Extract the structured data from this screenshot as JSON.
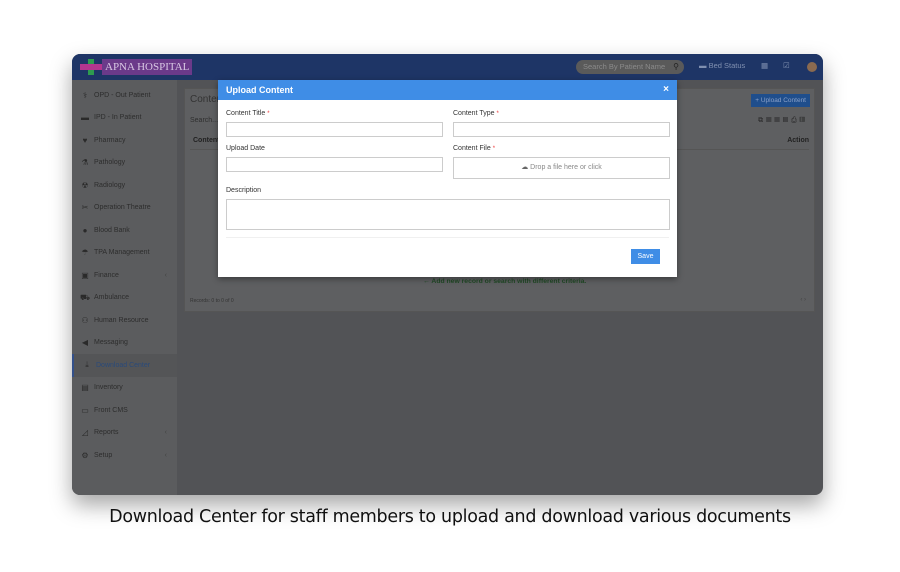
{
  "header": {
    "logo_text": "APNA HOSPITAL",
    "search_placeholder": "Search By Patient Name",
    "bed_status": "Bed Status"
  },
  "sidebar": {
    "items": [
      {
        "label": "OPD - Out Patient",
        "icon": "stethoscope-icon",
        "glyph": "⚕"
      },
      {
        "label": "IPD - In Patient",
        "icon": "bed-icon",
        "glyph": "▬"
      },
      {
        "label": "Pharmacy",
        "icon": "mortar-pestle-icon",
        "glyph": "♥"
      },
      {
        "label": "Pathology",
        "icon": "flask-icon",
        "glyph": "⚗"
      },
      {
        "label": "Radiology",
        "icon": "xray-icon",
        "glyph": "☢"
      },
      {
        "label": "Operation Theatre",
        "icon": "scissors-icon",
        "glyph": "✂"
      },
      {
        "label": "Blood Bank",
        "icon": "tint-icon",
        "glyph": "●"
      },
      {
        "label": "TPA Management",
        "icon": "umbrella-icon",
        "glyph": "☂"
      },
      {
        "label": "Finance",
        "icon": "money-icon",
        "glyph": "▣",
        "chevron": "‹"
      },
      {
        "label": "Ambulance",
        "icon": "ambulance-icon",
        "glyph": "⛟"
      },
      {
        "label": "Human Resource",
        "icon": "sitemap-icon",
        "glyph": "⚇"
      },
      {
        "label": "Messaging",
        "icon": "bullhorn-icon",
        "glyph": "◀"
      },
      {
        "label": "Download Center",
        "icon": "download-icon",
        "glyph": "⤓",
        "active": true
      },
      {
        "label": "Inventory",
        "icon": "inventory-icon",
        "glyph": "▤"
      },
      {
        "label": "Front CMS",
        "icon": "desktop-icon",
        "glyph": "▭"
      },
      {
        "label": "Reports",
        "icon": "chart-icon",
        "glyph": "◿",
        "chevron": "‹"
      },
      {
        "label": "Setup",
        "icon": "gears-icon",
        "glyph": "⚙",
        "chevron": "‹"
      }
    ]
  },
  "panel": {
    "title": "Content",
    "upload_button": "+ Upload Content",
    "search": "Search...",
    "col_content": "Content",
    "col_action": "Action",
    "empty_message": "← Add new record or search with different criteria.",
    "records": "Records: 0 to 0 of 0",
    "pager": "‹ ›"
  },
  "modal": {
    "title": "Upload Content",
    "close": "×",
    "content_title_label": "Content Title",
    "content_type_label": "Content Type",
    "upload_date_label": "Upload Date",
    "content_file_label": "Content File",
    "drop_text": "Drop a file here or click",
    "description_label": "Description",
    "required_mark": "*",
    "save": "Save"
  },
  "caption": "Download Center for staff members to upload and download various documents",
  "colors": {
    "primary": "#3f8de6",
    "header": "#1e3566"
  }
}
